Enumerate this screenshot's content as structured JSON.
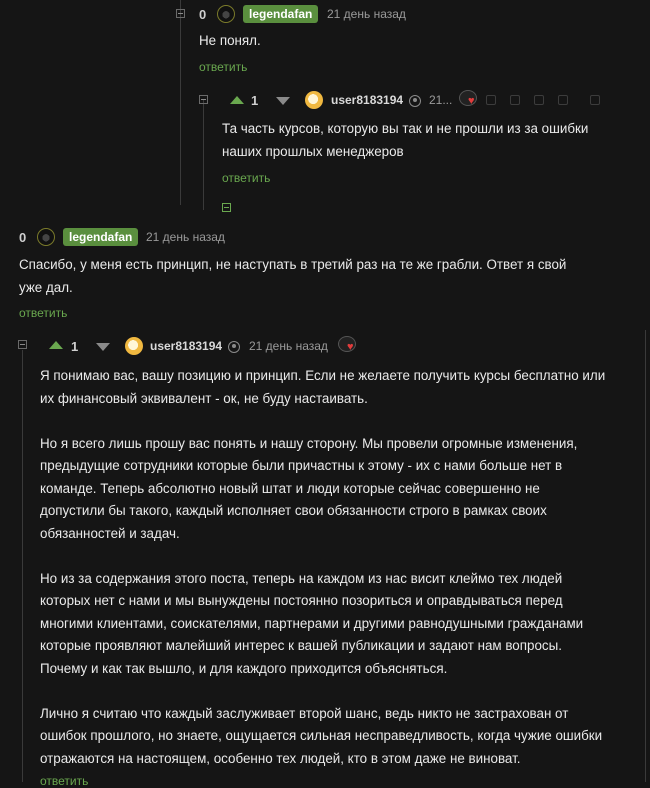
{
  "comments": [
    {
      "rating": "0",
      "author": "legendafan",
      "time": "21 день назад",
      "text": [
        "Не понял."
      ],
      "reply": "ответить"
    },
    {
      "rating": "1",
      "author": "user8183194",
      "time": "21...",
      "text": [
        "Та часть курсов, которую вы так и не прошли из за ошибки",
        "наших прошлых менеджеров"
      ],
      "reply": "ответить"
    },
    {
      "rating": "0",
      "author": "legendafan",
      "time": "21 день назад",
      "text": [
        "Спасибо, у меня есть принцип, не наступать в третий раз на те же грабли. Ответ я свой",
        "уже дал."
      ],
      "reply": "ответить"
    },
    {
      "rating": "1",
      "author": "user8183194",
      "time": "21 день назад",
      "text": [
        "Я понимаю вас, вашу позицию и принцип. Если не желаете получить курсы бесплатно или",
        "их финансовый эквивалент - ок, не буду настаивать.",
        "",
        "Но я всего лишь прошу вас понять и нашу сторону. Мы провели огромные изменения,",
        "предыдущие сотрудники которые были причастны к этому - их с нами больше нет в",
        "команде. Теперь абсолютно новый штат и люди которые сейчас совершенно не",
        "допустили бы такого, каждый исполняет свои обязанности строго в рамках своих",
        "обязанностей и задач.",
        "",
        "Но из за содержания этого поста, теперь на каждом из нас висит клеймо тех людей",
        "которых нет с нами и мы вынуждены постоянно позориться и оправдываться перед",
        "многими клиентами, соискателями, партнерами и другими равнодушными гражданами",
        "которые проявляют малейший интерес к вашей публикации и задают нам вопросы.",
        "Почему и как так вышло, и для каждого приходится объясняться.",
        "",
        "Лично я считаю что каждый заслуживает второй шанс, ведь никто не застрахован от",
        "ошибок прошлого, но знаете, ощущается сильная несправедливость, когда чужие ошибки",
        "отражаются на настоящем, особенно тех людей, кто в этом даже не виноват."
      ],
      "reply": "ответить"
    }
  ],
  "colors": {
    "background": "#151515",
    "accent": "#6aa84f",
    "badge": "#5a8f3e"
  }
}
